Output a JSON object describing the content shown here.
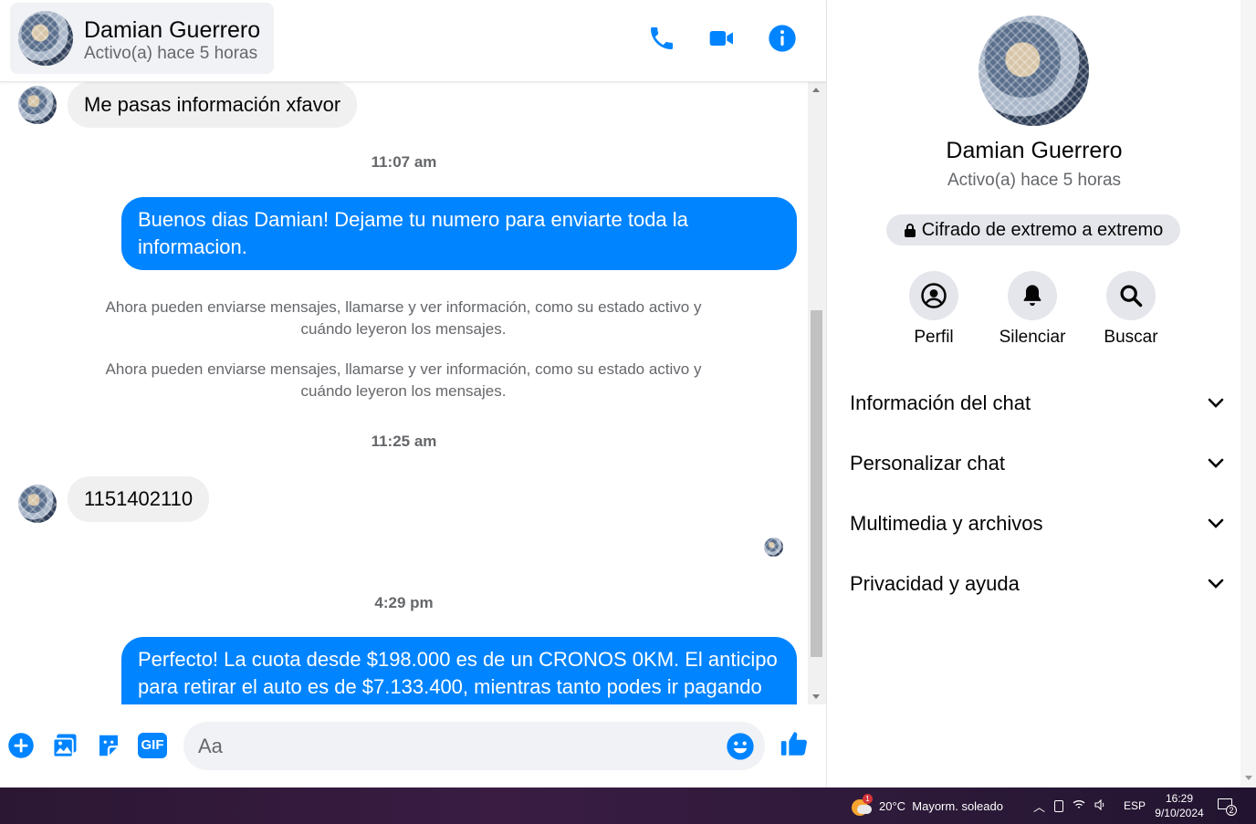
{
  "header": {
    "contact_name": "Damian Guerrero",
    "contact_status": "Activo(a) hace 5 horas",
    "icons": [
      "phone-icon",
      "video-icon",
      "info-icon"
    ]
  },
  "messages": {
    "msg1": "Me pasas información xfavor",
    "time1": "11:07 am",
    "msg2": "Buenos dias Damian! Dejame tu numero para enviarte toda la informacion.",
    "sys1": "Ahora pueden enviarse mensajes, llamarse y ver información, como su estado activo y cuándo leyeron los mensajes.",
    "sys2": "Ahora pueden enviarse mensajes, llamarse y ver información, como su estado activo y cuándo leyeron los mensajes.",
    "time2": "11:25 am",
    "msg3": "1151402110",
    "time3": "4:29 pm",
    "msg4": "Perfecto! La cuota desde $198.000 es de un CRONOS 0KM. El anticipo para retirar el auto es de $7.133.400, mientras tanto podes ir pagando"
  },
  "composer": {
    "placeholder": "Aa",
    "icons": [
      "plus-icon",
      "image-icon",
      "sticker-icon",
      "gif-icon",
      "emoji-icon",
      "thumbs-up-icon"
    ],
    "gif_label": "GIF"
  },
  "side": {
    "name": "Damian Guerrero",
    "status": "Activo(a) hace 5 horas",
    "e2e_label": "Cifrado de extremo a extremo",
    "actions": [
      {
        "label": "Perfil",
        "icon": "profile-icon"
      },
      {
        "label": "Silenciar",
        "icon": "bell-icon"
      },
      {
        "label": "Buscar",
        "icon": "search-icon"
      }
    ],
    "sections": [
      "Información del chat",
      "Personalizar chat",
      "Multimedia y archivos",
      "Privacidad y ayuda"
    ]
  },
  "taskbar": {
    "weather": "20°C  Mayorm. soleado",
    "lang": "ESP",
    "time": "16:29",
    "date": "9/10/2024",
    "notif_count": "2",
    "weather_badge": "1"
  },
  "colors": {
    "accent": "#0084ff",
    "incoming_bubble": "#f0f0f0",
    "muted_text": "#65676b"
  }
}
